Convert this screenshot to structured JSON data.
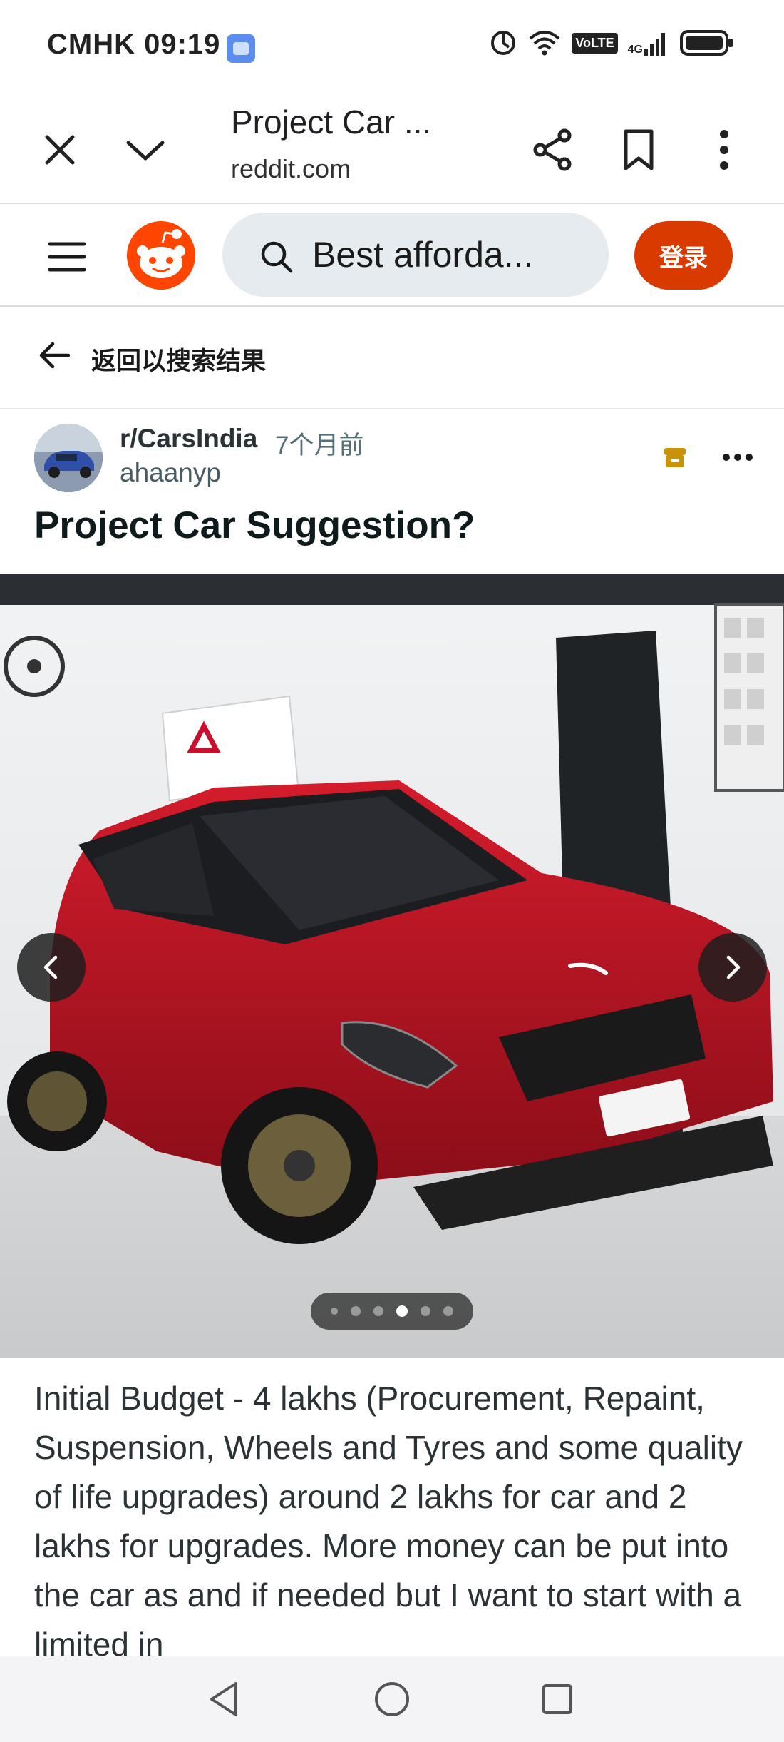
{
  "status_bar": {
    "carrier_time": "CMHK 09:19",
    "network": "4G",
    "volte": "VoLTE"
  },
  "browser": {
    "page_title": "Project Car ...",
    "domain": "reddit.com",
    "icons": [
      "close-icon",
      "chevron-down-icon",
      "share-icon",
      "bookmark-icon",
      "more-vertical-icon"
    ]
  },
  "reddit_header": {
    "search_text": "Best afforda...",
    "login_label": "登录",
    "brand_color": "#ff4500",
    "login_color": "#d93a00"
  },
  "back_link": {
    "label": "返回以搜索结果"
  },
  "post": {
    "subreddit": "r/CarsIndia",
    "time_ago": "7个月前",
    "author": "ahaanyp",
    "title": "Project Car Suggestion?",
    "body": "Initial Budget - 4 lakhs (Procurement, Repaint, Suspension, Wheels and Tyres and some quality of life upgrades) around 2 lakhs for car and 2 lakhs for upgrades. More money can be put into the car as and if needed but I want to start with a limited in",
    "gallery": {
      "image_count": 6,
      "active_index": 3,
      "description_icon": "red-hatchback-photo"
    }
  },
  "system_nav": {
    "icons": [
      "back-triangle-icon",
      "home-circle-icon",
      "recents-square-icon"
    ]
  }
}
